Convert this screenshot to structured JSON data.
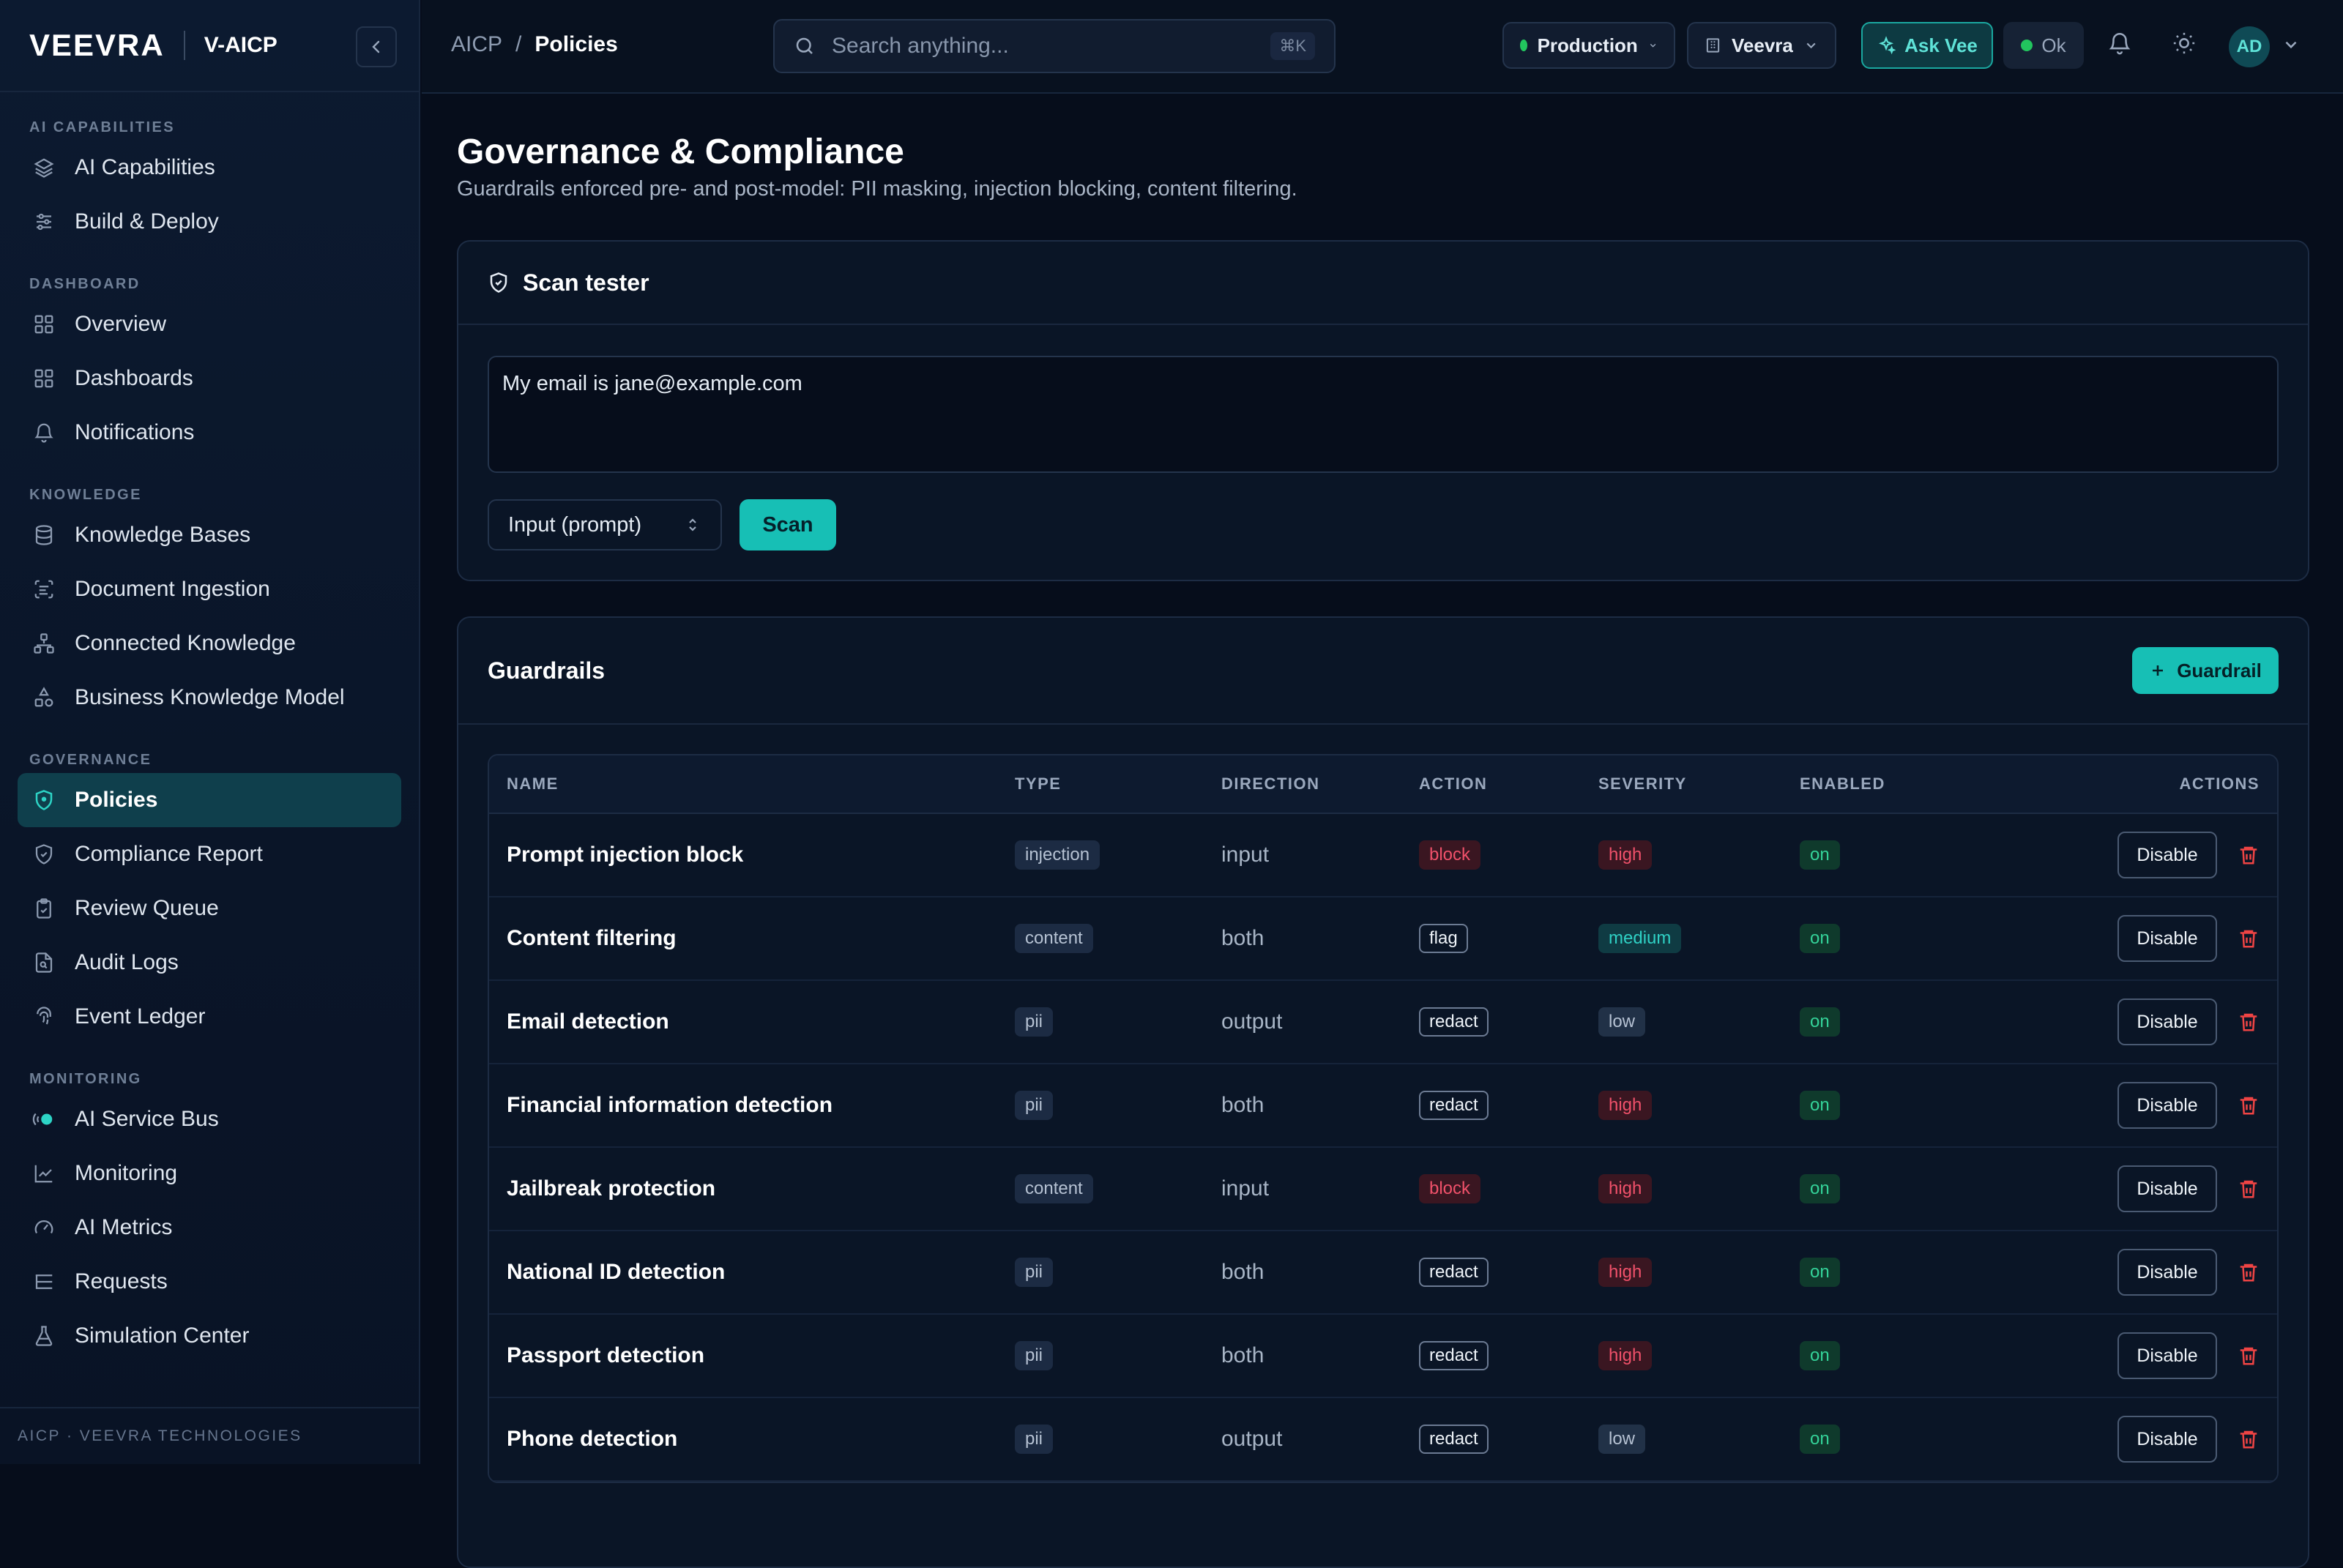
{
  "app": {
    "brand": "VEEVRA",
    "product": "V-AICP"
  },
  "sidebar": {
    "sections": [
      {
        "title": "AI CAPABILITIES",
        "items": [
          "AI Capabilities",
          "Build & Deploy"
        ]
      },
      {
        "title": "DASHBOARD",
        "items": [
          "Overview",
          "Dashboards",
          "Notifications"
        ]
      },
      {
        "title": "KNOWLEDGE",
        "items": [
          "Knowledge Bases",
          "Document Ingestion",
          "Connected Knowledge",
          "Business Knowledge Model"
        ]
      },
      {
        "title": "GOVERNANCE",
        "items": [
          "Policies",
          "Compliance Report",
          "Review Queue",
          "Audit Logs",
          "Event Ledger"
        ]
      },
      {
        "title": "MONITORING",
        "items": [
          "AI Service Bus",
          "Monitoring",
          "AI Metrics",
          "Requests",
          "Simulation Center"
        ]
      }
    ],
    "active": "Policies",
    "footer": "AICP · VEEVRA TECHNOLOGIES"
  },
  "topbar": {
    "breadcrumb_root": "AICP",
    "breadcrumb_sep": "/",
    "breadcrumb_current": "Policies",
    "search_placeholder": "Search anything...",
    "search_shortcut": "⌘K",
    "environment": "Production",
    "org": "Veevra",
    "ask_label": "Ask Vee",
    "status_label": "Ok",
    "avatar_initials": "AD"
  },
  "page": {
    "title": "Governance & Compliance",
    "subtitle": "Guardrails enforced pre- and post-model: PII masking, injection blocking, content filtering."
  },
  "scan": {
    "title": "Scan tester",
    "input_value": "My email is jane@example.com",
    "select_value": "Input (prompt)",
    "button": "Scan"
  },
  "guardrails": {
    "title": "Guardrails",
    "add_button": "Guardrail",
    "columns": [
      "NAME",
      "TYPE",
      "DIRECTION",
      "ACTION",
      "SEVERITY",
      "ENABLED",
      "ACTIONS"
    ],
    "disable_label": "Disable",
    "rows": [
      {
        "name": "Prompt injection block",
        "type": "injection",
        "direction": "input",
        "action": "block",
        "severity": "high",
        "enabled": "on"
      },
      {
        "name": "Content filtering",
        "type": "content",
        "direction": "both",
        "action": "flag",
        "severity": "medium",
        "enabled": "on"
      },
      {
        "name": "Email detection",
        "type": "pii",
        "direction": "output",
        "action": "redact",
        "severity": "low",
        "enabled": "on"
      },
      {
        "name": "Financial information detection",
        "type": "pii",
        "direction": "both",
        "action": "redact",
        "severity": "high",
        "enabled": "on"
      },
      {
        "name": "Jailbreak protection",
        "type": "content",
        "direction": "input",
        "action": "block",
        "severity": "high",
        "enabled": "on"
      },
      {
        "name": "National ID detection",
        "type": "pii",
        "direction": "both",
        "action": "redact",
        "severity": "high",
        "enabled": "on"
      },
      {
        "name": "Passport detection",
        "type": "pii",
        "direction": "both",
        "action": "redact",
        "severity": "high",
        "enabled": "on"
      },
      {
        "name": "Phone detection",
        "type": "pii",
        "direction": "output",
        "action": "redact",
        "severity": "low",
        "enabled": "on"
      }
    ]
  }
}
